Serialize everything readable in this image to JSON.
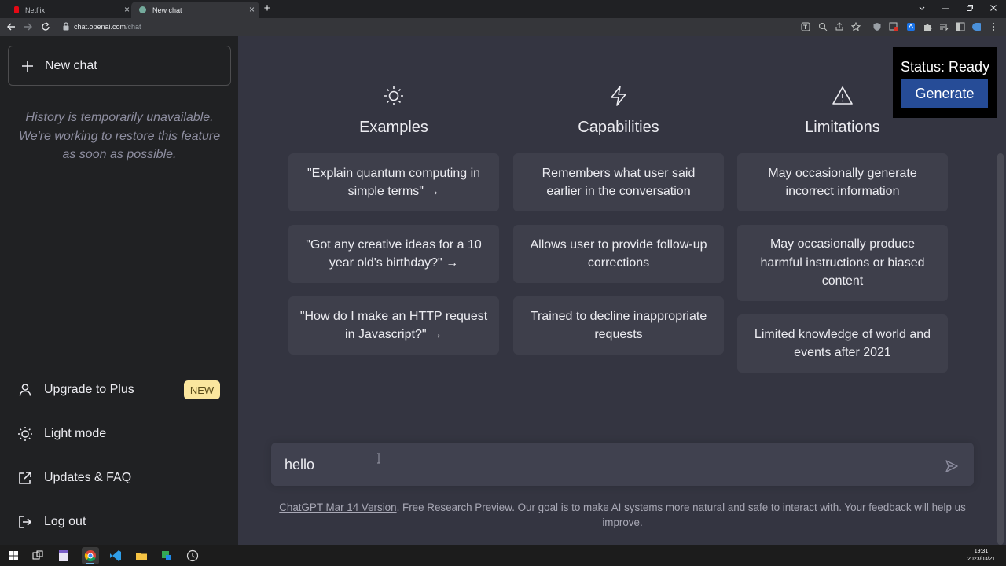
{
  "browser": {
    "tabs": [
      {
        "title": "Netflix",
        "favicon_color": "#e50914",
        "active": false
      },
      {
        "title": "New chat",
        "favicon_color": "#74aa9c",
        "active": true
      }
    ],
    "url_host": "chat.openai.com",
    "url_path": "/chat",
    "close_glyph": "×",
    "new_tab_glyph": "+"
  },
  "sidebar": {
    "new_chat_label": "New chat",
    "history_notice": "History is temporarily unavailable. We're working to restore this feature as soon as possible.",
    "items": [
      {
        "label": "Upgrade to Plus",
        "icon": "user-icon"
      },
      {
        "label": "Light mode",
        "icon": "sun-icon"
      },
      {
        "label": "Updates & FAQ",
        "icon": "external-link-icon"
      },
      {
        "label": "Log out",
        "icon": "logout-icon"
      }
    ],
    "new_badge": "NEW"
  },
  "columns": [
    {
      "title": "Examples",
      "icon": "sun-icon",
      "cards": [
        "\"Explain quantum computing in simple terms\" →",
        "\"Got any creative ideas for a 10 year old's birthday?\" →",
        "\"How do I make an HTTP request in Javascript?\" →"
      ]
    },
    {
      "title": "Capabilities",
      "icon": "lightning-icon",
      "cards": [
        "Remembers what user said earlier in the conversation",
        "Allows user to provide follow-up corrections",
        "Trained to decline inappropriate requests"
      ]
    },
    {
      "title": "Limitations",
      "icon": "warning-icon",
      "cards": [
        "May occasionally generate incorrect information",
        "May occasionally produce harmful instructions or biased content",
        "Limited knowledge of world and events after 2021"
      ]
    }
  ],
  "overlay": {
    "status": "Status: Ready",
    "generate_label": "Generate"
  },
  "composer": {
    "value": "hello"
  },
  "footer": {
    "link_text": "ChatGPT Mar 14 Version",
    "text": ". Free Research Preview. Our goal is to make AI systems more natural and safe to interact with. Your feedback will help us improve."
  },
  "taskbar": {
    "time": "19:31",
    "date": "2023/03/21"
  },
  "colors": {
    "sidebar_bg": "#202123",
    "main_bg": "#343541",
    "card_bg": "#3e3f4b",
    "generate_bg": "#264c97",
    "badge_bg": "#fae69e"
  }
}
